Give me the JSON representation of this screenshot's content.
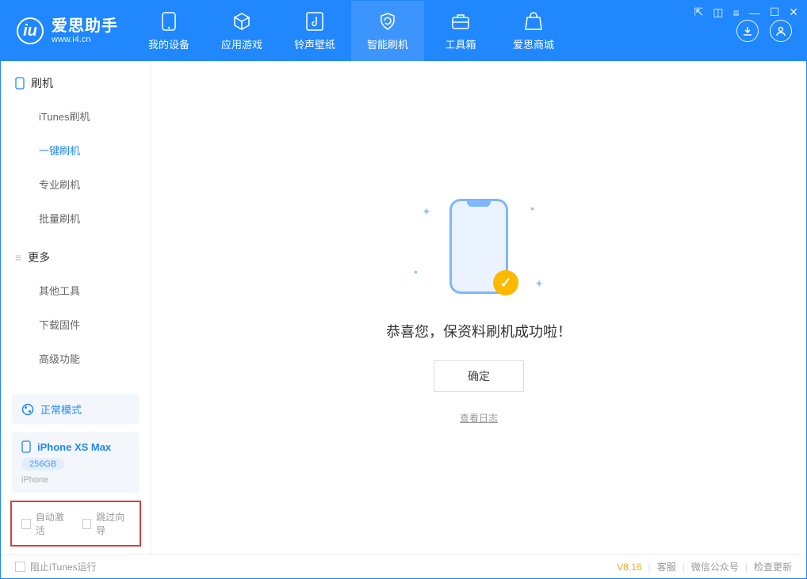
{
  "app": {
    "title": "爱思助手",
    "subtitle": "www.i4.cn"
  },
  "tabs": {
    "t0": "我的设备",
    "t1": "应用游戏",
    "t2": "铃声壁纸",
    "t3": "智能刷机",
    "t4": "工具箱",
    "t5": "爱思商城"
  },
  "sidebar": {
    "section1": "刷机",
    "items1": {
      "i0": "iTunes刷机",
      "i1": "一键刷机",
      "i2": "专业刷机",
      "i3": "批量刷机"
    },
    "section2": "更多",
    "items2": {
      "i0": "其他工具",
      "i1": "下载固件",
      "i2": "高级功能"
    },
    "mode": "正常模式",
    "device": {
      "name": "iPhone XS Max",
      "storage": "256GB",
      "type": "iPhone"
    },
    "opt1": "自动激活",
    "opt2": "跳过向导"
  },
  "main": {
    "success": "恭喜您，保资料刷机成功啦！",
    "ok": "确定",
    "log": "查看日志"
  },
  "status": {
    "block_itunes": "阻止iTunes运行",
    "version": "V8.16",
    "l1": "客服",
    "l2": "微信公众号",
    "l3": "检查更新"
  }
}
